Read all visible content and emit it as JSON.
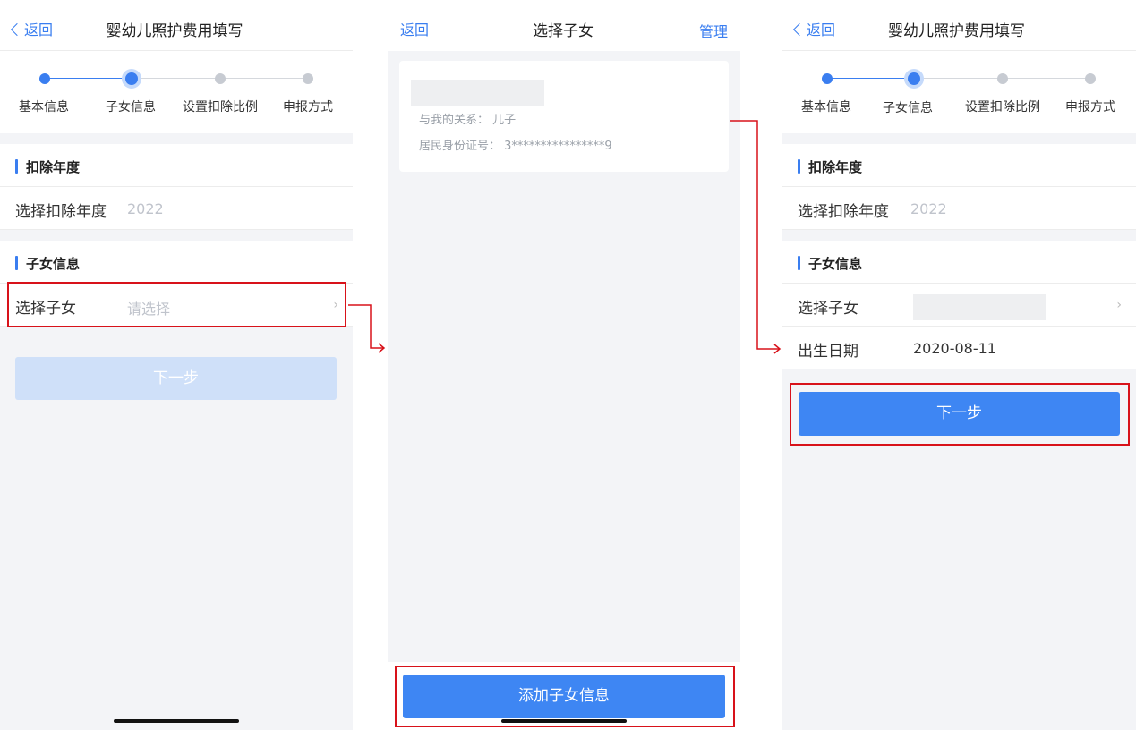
{
  "screen1": {
    "back_label": "返回",
    "title": "婴幼儿照护费用填写",
    "steps": [
      "基本信息",
      "子女信息",
      "设置扣除比例",
      "申报方式"
    ],
    "section_year": "扣除年度",
    "year_label": "选择扣除年度",
    "year_value": "2022",
    "section_child": "子女信息",
    "child_label": "选择子女",
    "child_placeholder": "请选择",
    "next_label": "下一步"
  },
  "screen2": {
    "back_label": "返回",
    "title": "选择子女",
    "manage_label": "管理",
    "card": {
      "relation": "与我的关系： 儿子",
      "id_number": "居民身份证号： 3****************9"
    },
    "add_label": "添加子女信息"
  },
  "screen3": {
    "back_label": "返回",
    "title": "婴幼儿照护费用填写",
    "steps": [
      "基本信息",
      "子女信息",
      "设置扣除比例",
      "申报方式"
    ],
    "section_year": "扣除年度",
    "year_label": "选择扣除年度",
    "year_value": "2022",
    "section_child": "子女信息",
    "child_label": "选择子女",
    "birth_label": "出生日期",
    "birth_value": "2020-08-11",
    "next_label": "下一步"
  },
  "icons": {
    "back": "chevron-left-icon",
    "row_arrow": "chevron-right-icon",
    "connector": "arrow-right-icon"
  },
  "colors": {
    "accent": "#3a7ef0",
    "button": "#3e86f3",
    "button_disabled": "#cfe0f9",
    "highlight": "#d8121a",
    "background": "#f3f4f7"
  }
}
